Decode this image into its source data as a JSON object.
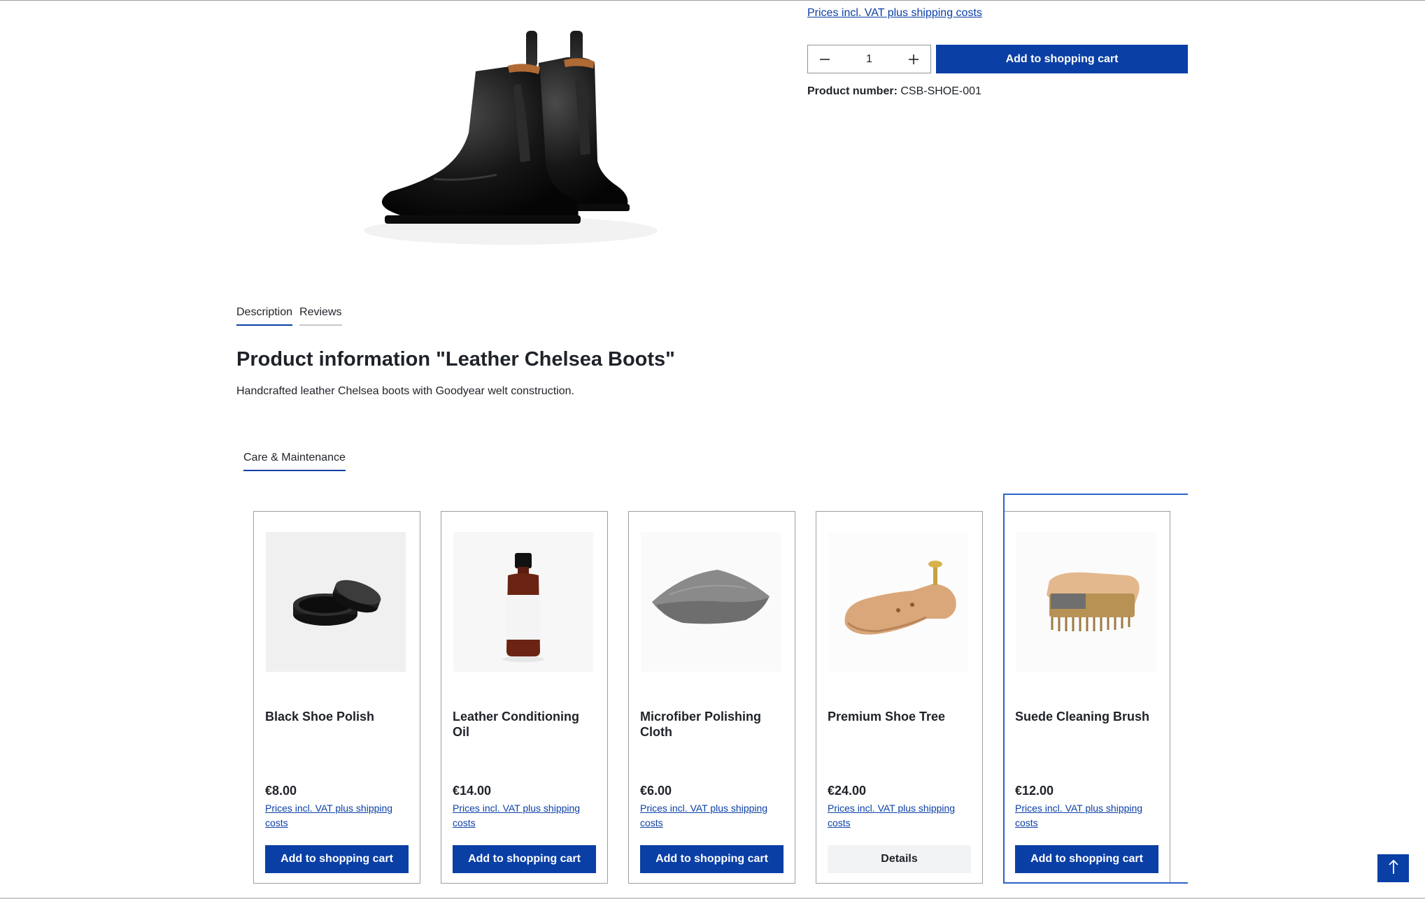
{
  "buy_box": {
    "price_note": "Prices incl. VAT plus shipping costs",
    "quantity": "1",
    "add_to_cart_label": "Add to shopping cart",
    "product_number_label": "Product number:",
    "product_number_value": "CSB-SHOE-001"
  },
  "tabs": [
    {
      "label": "Description",
      "active": true
    },
    {
      "label": "Reviews",
      "active": false
    }
  ],
  "product_info": {
    "title": "Product information \"Leather Chelsea Boots\"",
    "description": "Handcrafted leather Chelsea boots with Goodyear welt construction."
  },
  "cross_selling": {
    "tab_label": "Care & Maintenance",
    "products": [
      {
        "name": "Black Shoe Polish",
        "price": "€8.00",
        "vat_note": "Prices incl. VAT plus shipping costs",
        "button": "Add to shopping cart",
        "image": "shoe-polish-tin-image"
      },
      {
        "name": "Leather Conditioning Oil",
        "price": "€14.00",
        "vat_note": "Prices incl. VAT plus shipping costs",
        "button": "Add to shopping cart",
        "image": "oil-bottle-image"
      },
      {
        "name": "Microfiber Polishing Cloth",
        "price": "€6.00",
        "vat_note": "Prices incl. VAT plus shipping costs",
        "button": "Add to shopping cart",
        "image": "polishing-cloth-image"
      },
      {
        "name": "Premium Shoe Tree",
        "price": "€24.00",
        "vat_note": "Prices incl. VAT plus shipping costs",
        "button": "Details",
        "image": "shoe-tree-image"
      },
      {
        "name": "Suede Cleaning Brush",
        "price": "€12.00",
        "vat_note": "Prices incl. VAT plus shipping costs",
        "button": "Add to shopping cart",
        "image": "suede-brush-image"
      }
    ]
  },
  "colors": {
    "brand_blue": "#0a3fa6",
    "link_blue": "#0b3fa6",
    "text": "#1f2329"
  },
  "icons": {
    "minus": "minus-icon",
    "plus": "plus-icon",
    "scroll_top": "arrow-up-icon"
  }
}
